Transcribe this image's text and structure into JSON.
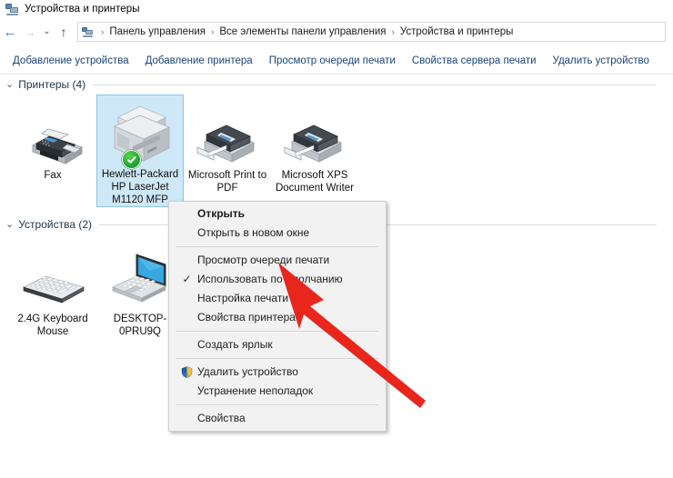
{
  "window": {
    "title": "Устройства и принтеры",
    "title_icon": "devices-and-printers-icon"
  },
  "address_bar": {
    "back_icon": "back-arrow-icon",
    "forward_icon": "forward-arrow-icon",
    "recent_icon": "chevron-down-icon",
    "up_icon": "up-arrow-icon",
    "path_icon": "devices-and-printers-icon",
    "separator": "›",
    "crumbs": [
      "Панель управления",
      "Все элементы панели управления",
      "Устройства и принтеры"
    ]
  },
  "command_bar": {
    "items": [
      "Добавление устройства",
      "Добавление принтера",
      "Просмотр очереди печати",
      "Свойства сервера печати",
      "Удалить устройство"
    ]
  },
  "groups": [
    {
      "id": "printers",
      "label": "Принтеры (4)",
      "chevron": "⌄",
      "items": [
        {
          "label": "Fax",
          "icon": "fax-machine-icon",
          "selected": false,
          "default_badge": false
        },
        {
          "label": "Hewlett-Packard HP LaserJet M1120 MFP",
          "icon": "laser-printer-icon",
          "selected": true,
          "default_badge": true
        },
        {
          "label": "Microsoft Print to PDF",
          "icon": "printer-icon",
          "selected": false,
          "default_badge": false
        },
        {
          "label": "Microsoft XPS Document Writer",
          "icon": "printer-icon",
          "selected": false,
          "default_badge": false
        }
      ]
    },
    {
      "id": "devices",
      "label": "Устройства (2)",
      "chevron": "⌄",
      "items": [
        {
          "label": "2.4G Keyboard Mouse",
          "icon": "keyboard-icon",
          "selected": false,
          "default_badge": false
        },
        {
          "label": "DESKTOP-0PRU9Q",
          "icon": "laptop-icon",
          "selected": false,
          "default_badge": false
        }
      ]
    }
  ],
  "context_menu": {
    "entries": [
      {
        "type": "item",
        "label": "Открыть",
        "bold": true,
        "check": false,
        "shield": false
      },
      {
        "type": "item",
        "label": "Открыть в новом окне",
        "bold": false,
        "check": false,
        "shield": false
      },
      {
        "type": "separator"
      },
      {
        "type": "item",
        "label": "Просмотр очереди печати",
        "bold": false,
        "check": false,
        "shield": false
      },
      {
        "type": "item",
        "label": "Использовать по умолчанию",
        "bold": false,
        "check": true,
        "shield": false
      },
      {
        "type": "item",
        "label": "Настройка печати",
        "bold": false,
        "check": false,
        "shield": false
      },
      {
        "type": "item",
        "label": "Свойства принтера",
        "bold": false,
        "check": false,
        "shield": false
      },
      {
        "type": "separator"
      },
      {
        "type": "item",
        "label": "Создать ярлык",
        "bold": false,
        "check": false,
        "shield": false
      },
      {
        "type": "separator"
      },
      {
        "type": "item",
        "label": "Удалить устройство",
        "bold": false,
        "check": false,
        "shield": true
      },
      {
        "type": "item",
        "label": "Устранение неполадок",
        "bold": false,
        "check": false,
        "shield": false
      },
      {
        "type": "separator"
      },
      {
        "type": "item",
        "label": "Свойства",
        "bold": false,
        "check": false,
        "shield": false
      }
    ],
    "check_glyph": "✓"
  },
  "annotation": {
    "arrow_color": "#e8261c",
    "arrow_name": "red-pointer-arrow",
    "points_at": "Использовать по умолчанию"
  },
  "colors": {
    "selection_fill": "#cfe8f7",
    "selection_border": "#89c4e8",
    "link": "#18447e",
    "group_label": "#21374c",
    "menu_bg": "#f2f2f2",
    "default_badge_green": "#23a832"
  }
}
